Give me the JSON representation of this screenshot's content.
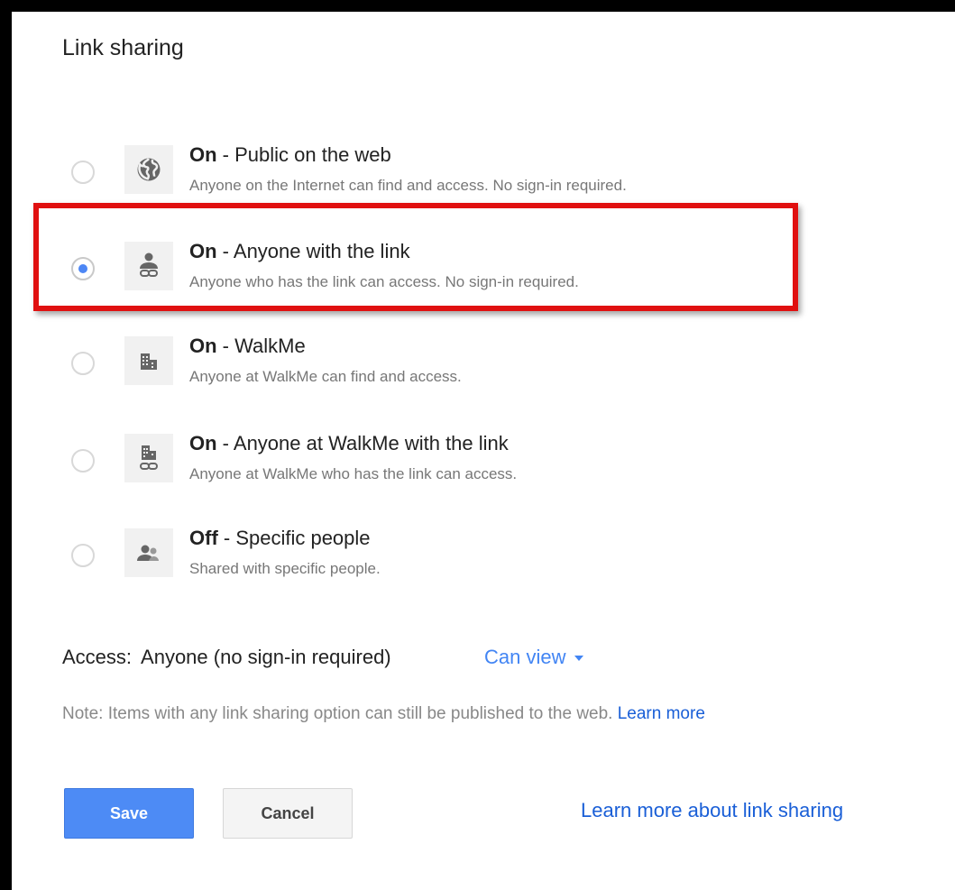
{
  "dialog": {
    "title": "Link sharing"
  },
  "options": [
    {
      "state": "On",
      "label": " - Public on the web",
      "description": "Anyone on the Internet can find and access. No sign-in required.",
      "icon": "globe-icon",
      "selected": false
    },
    {
      "state": "On",
      "label": " - Anyone with the link",
      "description": "Anyone who has the link can access. No sign-in required.",
      "icon": "person-link-icon",
      "selected": true
    },
    {
      "state": "On",
      "label": " - WalkMe",
      "description": "Anyone at WalkMe can find and access.",
      "icon": "building-icon",
      "selected": false
    },
    {
      "state": "On",
      "label": " - Anyone at WalkMe with the link",
      "description": "Anyone at WalkMe who has the link can access.",
      "icon": "building-link-icon",
      "selected": false
    },
    {
      "state": "Off",
      "label": " - Specific people",
      "description": "Shared with specific people.",
      "icon": "people-icon",
      "selected": false
    }
  ],
  "access": {
    "label": "Access:",
    "value": "Anyone (no sign-in required)",
    "permission": "Can view"
  },
  "note": {
    "text": "Note: Items with any link sharing option can still be published to the web.",
    "link": "Learn more"
  },
  "buttons": {
    "save": "Save",
    "cancel": "Cancel"
  },
  "learn_more_link": "Learn more about link sharing",
  "colors": {
    "accent": "#4285f4",
    "highlight": "#e01010",
    "link": "#1a5fd7"
  }
}
